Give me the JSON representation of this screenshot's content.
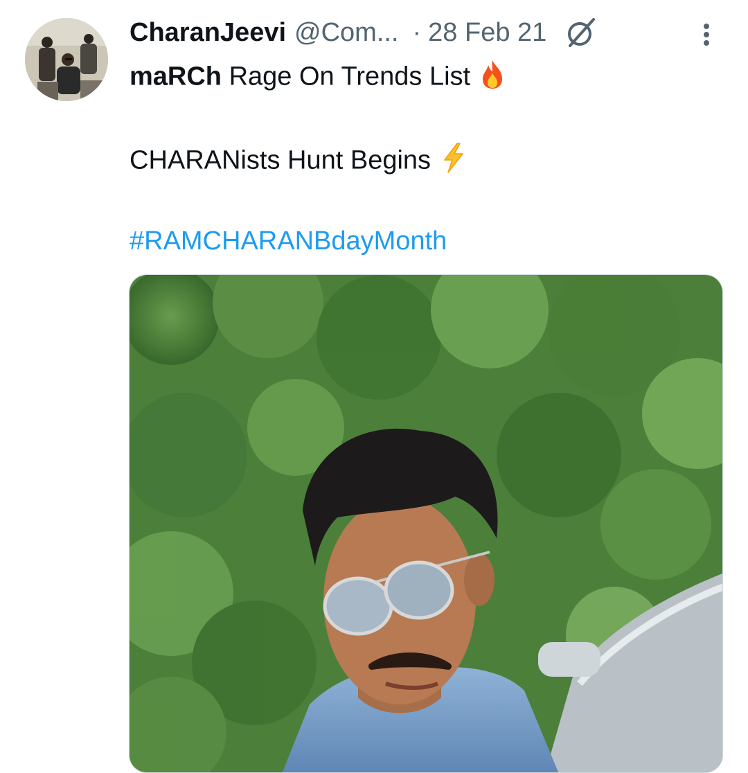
{
  "tweet": {
    "author": {
      "display_name": "CharanJeevi",
      "handle": "@Com...",
      "avatar_icon": "profile-photo"
    },
    "separator": "·",
    "date": "28 Feb 21",
    "edited_icon": "edited-indicator-icon",
    "more_icon": "more-options-icon",
    "text": {
      "line1_bold": "maRCh",
      "line1_rest": " Rage On Trends List",
      "line1_emoji": "fire-icon",
      "line2": "CHARANists Hunt Begins",
      "line2_emoji": "lightning-icon",
      "hashtag": "#RAMCHARANBdayMonth"
    },
    "media": {
      "kind": "photo",
      "description_icon": "man-in-sunglasses-photo"
    }
  },
  "colors": {
    "text_primary": "#0f1419",
    "text_secondary": "#536471",
    "hashtag": "#1d9bf0"
  }
}
